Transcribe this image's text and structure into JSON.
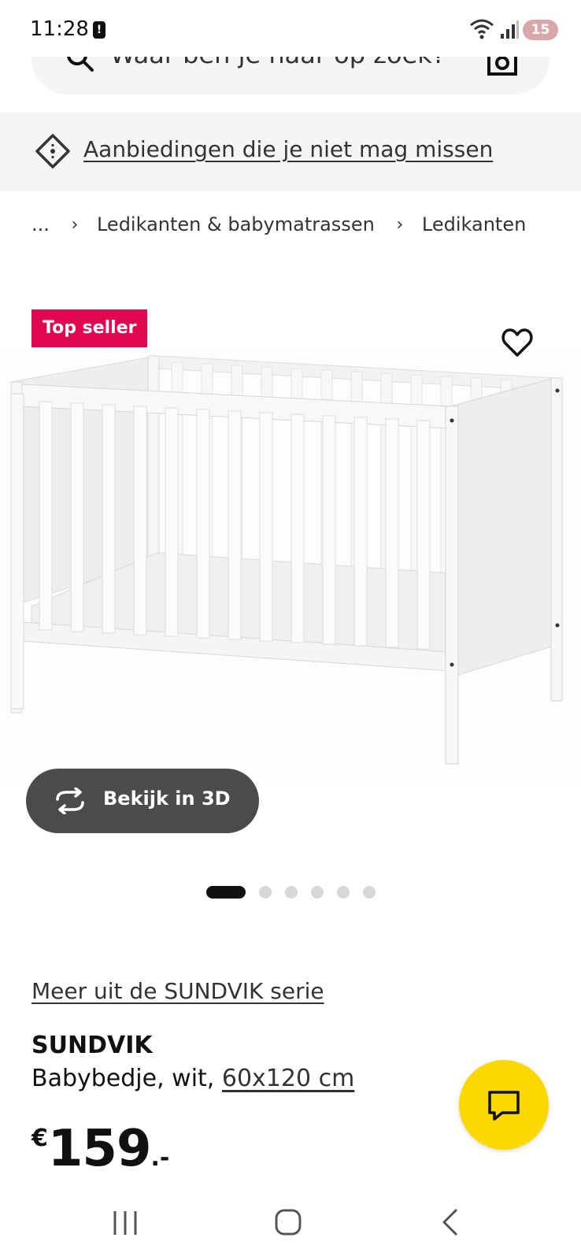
{
  "status_bar": {
    "time": "11:28",
    "battery": "15",
    "alert_glyph": "!"
  },
  "search": {
    "placeholder": "Waar ben je naar op zoek?",
    "icons": [
      "search-icon",
      "camera-icon"
    ]
  },
  "offers_banner": {
    "text": "Aanbiedingen die je niet mag missen",
    "icon": "tag-icon"
  },
  "breadcrumb": {
    "ellipsis": "...",
    "separator": "›",
    "items": [
      "Ledikanten & babymatrassen",
      "Ledikanten"
    ]
  },
  "product_image": {
    "badge": "Top seller",
    "favorite_icon": "heart-icon",
    "view_3d_label": "Bekijk in 3D",
    "carousel": {
      "total": 6,
      "active_index": 0
    }
  },
  "product": {
    "series_link": "Meer uit de SUNDVIK serie",
    "name": "SUNDVIK",
    "description": "Babybedje, wit, ",
    "dimensions": "60x120 cm",
    "price_currency": "€",
    "price_amount": "159",
    "price_decimals": ".-"
  },
  "colors": {
    "badge": "#e00751",
    "chat_button": "#fcd700",
    "view_3d_button": "#4b4b4b"
  }
}
